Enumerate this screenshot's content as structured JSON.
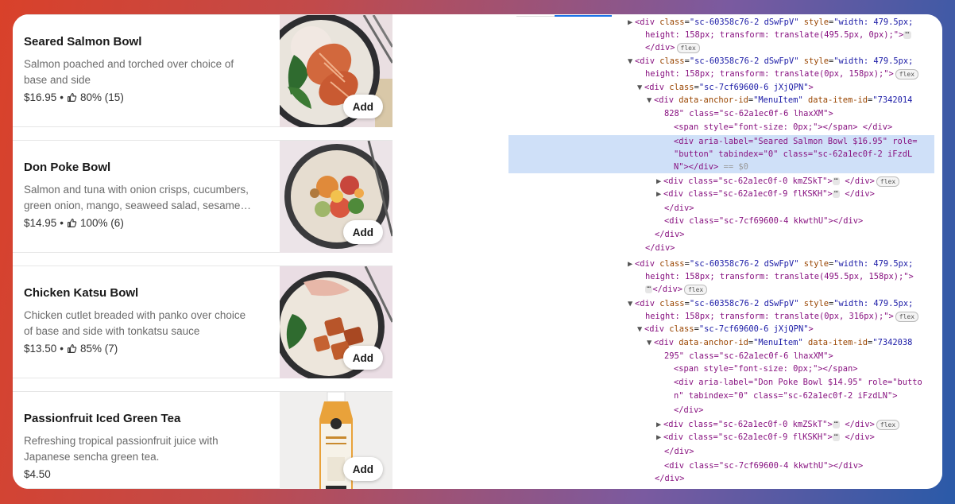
{
  "menu": {
    "items": [
      {
        "title": "Seared Salmon Bowl",
        "description": "Salmon poached and torched over choice of base and side",
        "price": "$16.95",
        "separator": "•",
        "rating": "80% (15)",
        "add_label": "Add"
      },
      {
        "title": "Don Poke Bowl",
        "description": "Salmon and tuna with onion crisps, cucumbers, green onion, mango, seaweed salad, sesame seeds",
        "price": "$14.95",
        "separator": "•",
        "rating": "100% (6)",
        "add_label": "Add"
      },
      {
        "title": "Chicken Katsu Bowl",
        "description": "Chicken cutlet breaded with panko over choice of base and side with tonkatsu sauce",
        "price": "$13.50",
        "separator": "•",
        "rating": "85% (7)",
        "add_label": "Add"
      },
      {
        "title": "Passionfruit Iced Green Tea",
        "description": "Refreshing tropical passionfruit juice with Japanese sencha green tea.",
        "price": "$4.50",
        "separator": "",
        "rating": "",
        "add_label": "Add"
      }
    ]
  },
  "devtools": {
    "badge_flex": "flex",
    "ellipsis": "⋯",
    "lines": [
      {
        "tri": "▶",
        "pre": "<div ",
        "a1n": "class",
        "a1v": "\"sc-60358c76-2 dSwFpV\"",
        "a2n": "style",
        "a2v": "\"width: 479.5px;"
      },
      {
        "text": "height: 158px; transform: translate(495.5px, 0px);\">"
      },
      {
        "text": "</div>"
      },
      {
        "tri": "▼",
        "pre": "<div ",
        "a1n": "class",
        "a1v": "\"sc-60358c76-2 dSwFpV\"",
        "a2n": "style",
        "a2v": "\"width: 479.5px;"
      },
      {
        "text": "height: 158px; transform: translate(0px, 158px);\">"
      },
      {
        "tri": "▼",
        "pre": "<div ",
        "a1n": "class",
        "a1v": "\"sc-7cf69600-6 jXjQPN\"",
        "post": ">"
      },
      {
        "tri": "▼",
        "pre": "<div ",
        "a1n": "data-anchor-id",
        "a1v": "\"MenuItem\"",
        "a2n": "data-item-id",
        "a2v": "\"7342014"
      },
      {
        "text": "828\" class=\"sc-62a1ec0f-6 lhaxXM\">"
      },
      {
        "text": "<span style=\"font-size: 0px;\"></span>"
      },
      {
        "text": "<div aria-label=\"Seared Salmon Bowl $16.95\" role="
      },
      {
        "text": "\"button\" tabindex=\"0\" class=\"sc-62a1ec0f-2 iFzdL"
      },
      {
        "text": "N\"></div>",
        "suffix": " == $0"
      },
      {
        "tri": "▶",
        "text": "<div class=\"sc-62a1ec0f-0 kmZSkT\">"
      },
      {
        "tri": "▶",
        "text": "<div class=\"sc-62a1ec0f-9 flKSKH\">"
      },
      {
        "text": "</div>"
      },
      {
        "text": "<div class=\"sc-7cf69600-4 kkwthU\"></div>"
      },
      {
        "text": "</div>"
      },
      {
        "text": "</div>"
      },
      {
        "tri": "▶",
        "pre": "<div ",
        "a1n": "class",
        "a1v": "\"sc-60358c76-2 dSwFpV\"",
        "a2n": "style",
        "a2v": "\"width: 479.5px;"
      },
      {
        "text": "height: 158px; transform: translate(495.5px, 158px);\">"
      },
      {
        "text": "</div>"
      },
      {
        "tri": "▼",
        "pre": "<div ",
        "a1n": "class",
        "a1v": "\"sc-60358c76-2 dSwFpV\"",
        "a2n": "style",
        "a2v": "\"width: 479.5px;"
      },
      {
        "text": "height: 158px; transform: translate(0px, 316px);\">"
      },
      {
        "tri": "▼",
        "pre": "<div ",
        "a1n": "class",
        "a1v": "\"sc-7cf69600-6 jXjQPN\"",
        "post": ">"
      },
      {
        "tri": "▼",
        "pre": "<div ",
        "a1n": "data-anchor-id",
        "a1v": "\"MenuItem\"",
        "a2n": "data-item-id",
        "a2v": "\"7342038"
      },
      {
        "text": "295\" class=\"sc-62a1ec0f-6 lhaxXM\">"
      },
      {
        "text": "<span style=\"font-size: 0px;\"></span>"
      },
      {
        "text": "<div aria-label=\"Don Poke Bowl $14.95\" role=\"butto"
      },
      {
        "text": "n\" tabindex=\"0\" class=\"sc-62a1ec0f-2 iFzdLN\">"
      },
      {
        "text": "</div>"
      },
      {
        "tri": "▶",
        "text": "<div class=\"sc-62a1ec0f-0 kmZSkT\">"
      },
      {
        "tri": "▶",
        "text": "<div class=\"sc-62a1ec0f-9 flKSKH\">"
      },
      {
        "text": "</div>"
      },
      {
        "text": "<div class=\"sc-7cf69600-4 kkwthU\"></div>"
      },
      {
        "text": "</div>"
      }
    ]
  }
}
